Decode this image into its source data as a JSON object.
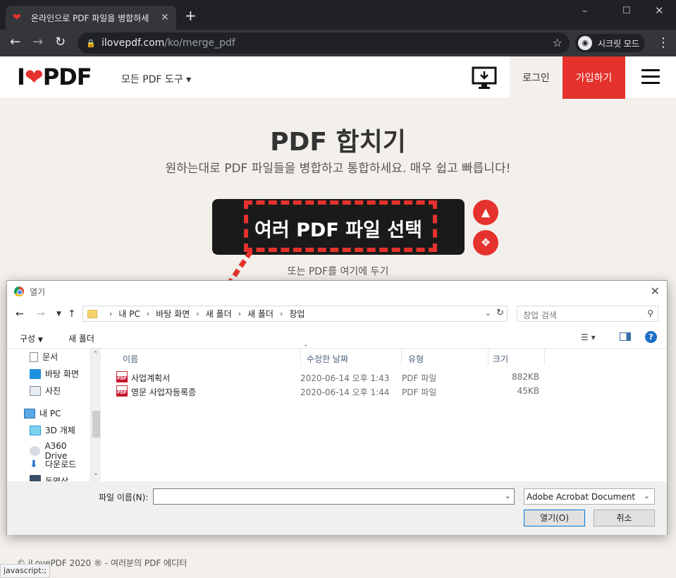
{
  "browser": {
    "tab_title": "온라인으로 PDF 파일을 병합하세",
    "url_host": "ilovepdf.com",
    "url_path": "/ko/merge_pdf",
    "incognito_label": "시크릿 모드"
  },
  "site": {
    "logo_pre": "I",
    "logo_post": "PDF",
    "tools_menu": "모든 PDF 도구",
    "login": "로그인",
    "signup": "가입하기"
  },
  "hero": {
    "title": "PDF 합치기",
    "subtitle": "원하는대로 PDF 파일들을 병합하고 통합하세요. 매우 쉽고 빠릅니다!",
    "select_button": "여러 PDF 파일 선택",
    "drop_text": "또는 PDF를 여기에 두기"
  },
  "footer": {
    "copyright": "© iLovePDF 2020 ® - 여러분의 PDF 에디터",
    "status": "javascript:;"
  },
  "dialog": {
    "title": "열기",
    "breadcrumbs": [
      "내 PC",
      "바탕 화면",
      "새 폴더",
      "새 폴더",
      "창업"
    ],
    "search_placeholder": "창업 검색",
    "organize": "구성",
    "new_folder": "새 폴더",
    "tree": [
      {
        "label": "문서"
      },
      {
        "label": "바탕 화면"
      },
      {
        "label": "사진"
      },
      {
        "label": "내 PC"
      },
      {
        "label": "3D 개체"
      },
      {
        "label": "A360 Drive"
      },
      {
        "label": "다운로드"
      },
      {
        "label": "동영상"
      }
    ],
    "columns": [
      "이름",
      "수정한 날짜",
      "유형",
      "크기"
    ],
    "files": [
      {
        "name": "사업계획서",
        "date": "2020-06-14 오후 1:43",
        "type": "PDF 파일",
        "size": "882KB"
      },
      {
        "name": "영문 사업자등록증",
        "date": "2020-06-14 오후 1:44",
        "type": "PDF 파일",
        "size": "45KB"
      }
    ],
    "filename_label": "파일 이름(N):",
    "filename_value": "",
    "file_type": "Adobe Acrobat Document",
    "open_button": "열기(O)",
    "cancel_button": "취소"
  },
  "colors": {
    "brand_red": "#e5322d",
    "chrome_dark": "#202124"
  }
}
